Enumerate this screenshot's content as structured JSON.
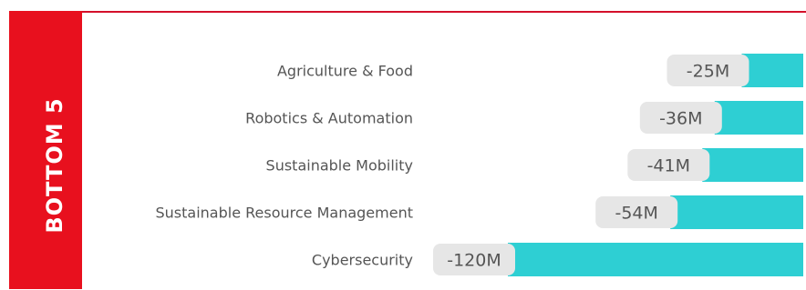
{
  "panel": {
    "side_label": "BOTTOM 5"
  },
  "colors": {
    "accent": "#e8101e",
    "bar": "#2ecfd3",
    "value_box": "#e6e6e6",
    "text": "#555555"
  },
  "chart_data": {
    "type": "bar",
    "orientation": "horizontal",
    "title": "",
    "categories": [
      "Agriculture & Food",
      "Robotics & Automation",
      "Sustainable Mobility",
      "Sustainable Resource Management",
      "Cybersecurity"
    ],
    "values": [
      -25,
      -36,
      -41,
      -54,
      -120
    ],
    "value_labels": [
      "-25M",
      "-36M",
      "-41M",
      "-54M",
      "-120M"
    ],
    "unit": "M",
    "xlim": [
      -120,
      0
    ],
    "grid": false,
    "legend": "none"
  }
}
